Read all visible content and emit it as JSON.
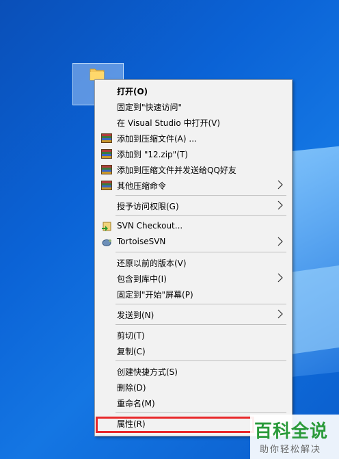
{
  "menu": {
    "items": [
      {
        "label": "打开(O)",
        "icon": "",
        "submenu": false,
        "bold": true
      },
      {
        "label": "固定到\"快速访问\"",
        "icon": "",
        "submenu": false
      },
      {
        "label": "在 Visual Studio 中打开(V)",
        "icon": "",
        "submenu": false
      },
      {
        "label": "添加到压缩文件(A) ...",
        "icon": "winrar-icon",
        "submenu": false
      },
      {
        "label": "添加到 \"12.zip\"(T)",
        "icon": "winrar-icon",
        "submenu": false
      },
      {
        "label": "添加到压缩文件并发送给QQ好友",
        "icon": "winrar-icon",
        "submenu": false
      },
      {
        "label": "其他压缩命令",
        "icon": "winrar-icon",
        "submenu": true
      },
      {
        "label": "授予访问权限(G)",
        "icon": "",
        "submenu": true
      },
      {
        "label": "SVN Checkout...",
        "icon": "svn-checkout-icon",
        "submenu": false
      },
      {
        "label": "TortoiseSVN",
        "icon": "tortoisesvn-icon",
        "submenu": true
      },
      {
        "label": "还原以前的版本(V)",
        "icon": "",
        "submenu": false
      },
      {
        "label": "包含到库中(I)",
        "icon": "",
        "submenu": true
      },
      {
        "label": "固定到\"开始\"屏幕(P)",
        "icon": "",
        "submenu": false
      },
      {
        "label": "发送到(N)",
        "icon": "",
        "submenu": true
      },
      {
        "label": "剪切(T)",
        "icon": "",
        "submenu": false
      },
      {
        "label": "复制(C)",
        "icon": "",
        "submenu": false
      },
      {
        "label": "创建快捷方式(S)",
        "icon": "",
        "submenu": false
      },
      {
        "label": "删除(D)",
        "icon": "",
        "submenu": false
      },
      {
        "label": "重命名(M)",
        "icon": "",
        "submenu": false
      },
      {
        "label": "属性(R)",
        "icon": "",
        "submenu": false
      }
    ]
  },
  "watermark": {
    "title": "百科全说",
    "subtitle": "助你轻松解决"
  },
  "colors": {
    "highlight": "#e8282a",
    "desktop": "#0b63d6",
    "brand": "#2a9a3a"
  }
}
